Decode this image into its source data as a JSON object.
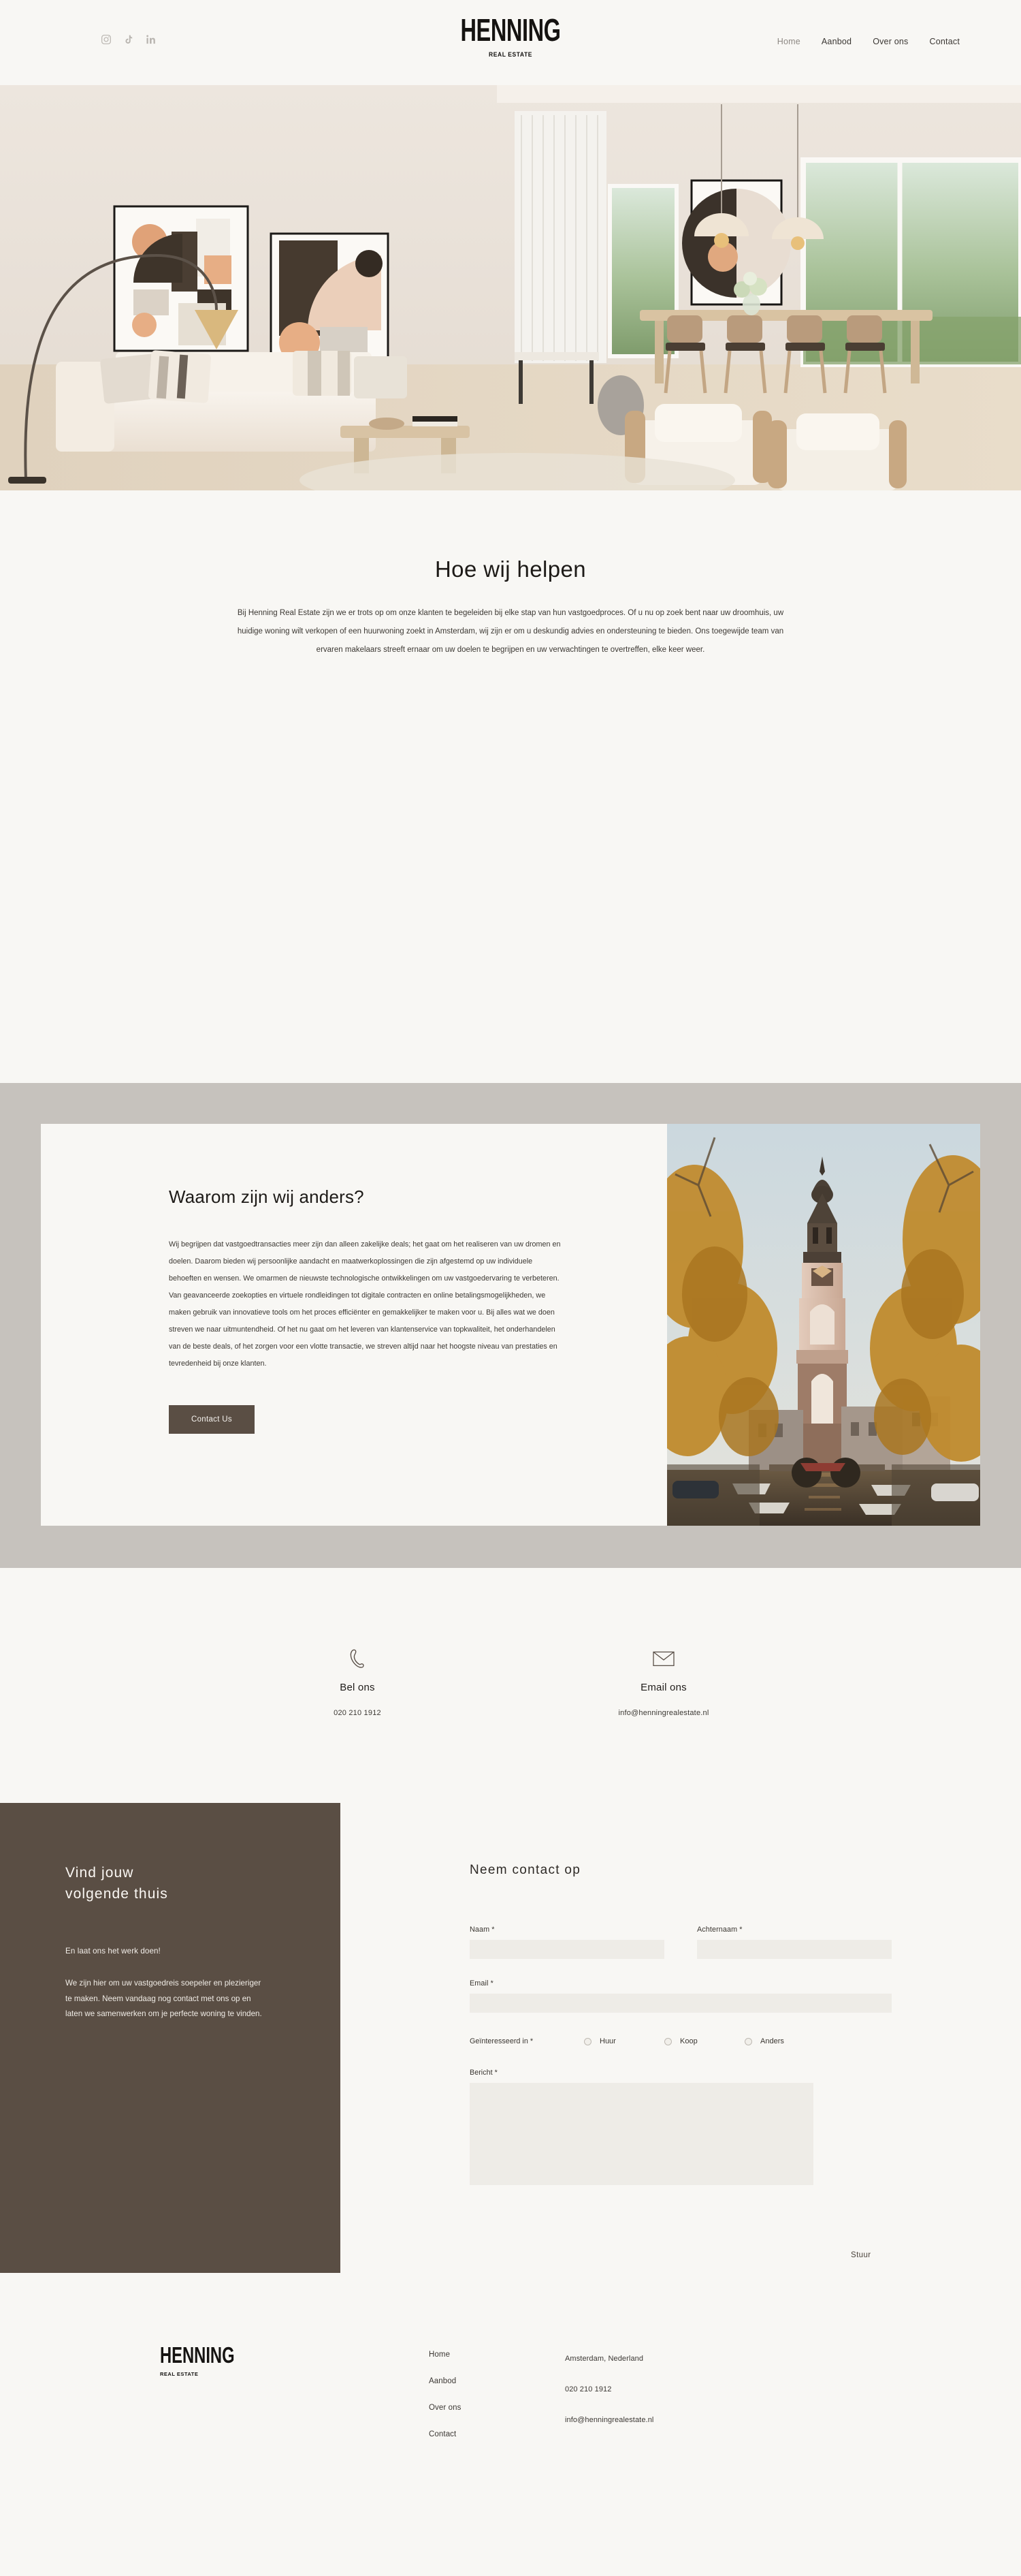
{
  "header": {
    "socials": [
      {
        "name": "instagram",
        "label": "Instagram"
      },
      {
        "name": "tiktok",
        "label": "TikTok"
      },
      {
        "name": "linkedin",
        "label": "LinkedIn"
      }
    ],
    "brand_name": "HENNING",
    "brand_sub": "REAL ESTATE",
    "nav": [
      {
        "label": "Home",
        "active": true
      },
      {
        "label": "Aanbod",
        "active": false
      },
      {
        "label": "Over ons",
        "active": false
      },
      {
        "label": "Contact",
        "active": false
      }
    ]
  },
  "hero": {
    "alt": "Modern beige living room with white sectional sofa, abstract framed art, arc floor lamp and dining area with garden view"
  },
  "help": {
    "title": "Hoe wij helpen",
    "body": "Bij Henning Real Estate zijn we er trots op om onze klanten te begeleiden bij elke stap van hun vastgoedproces. Of u nu op zoek bent naar uw droomhuis, uw huidige woning wilt verkopen of een huurwoning zoekt in Amsterdam, wij zijn er om u deskundig advies en ondersteuning te bieden. Ons toegewijde team van ervaren makelaars streeft ernaar om uw doelen te begrijpen en uw verwachtingen te overtreffen, elke keer weer."
  },
  "why": {
    "title": "Waarom zijn wij anders?",
    "body": "Wij begrijpen dat vastgoedtransacties meer zijn dan alleen zakelijke deals; het gaat om het realiseren van uw dromen en doelen. Daarom bieden wij persoonlijke aandacht en maatwerkoplossingen die zijn afgestemd op uw individuele behoeften en wensen. We omarmen de nieuwste technologische ontwikkelingen om uw vastgoedervaring te verbeteren. Van geavanceerde zoekopties en virtuele rondleidingen tot digitale contracten en online betalingsmogelijkheden, we maken gebruik van innovatieve tools om het proces efficiënter en gemakkelijker te maken voor u. Bij alles wat we doen streven we naar uitmuntendheid. Of het nu gaat om het leveren van klantenservice van topkwaliteit, het onderhandelen van de beste deals, of het zorgen voor een vlotte transactie, we streven altijd naar het hoogste niveau van prestaties en tevredenheid bij onze klanten.",
    "button": "Contact Us",
    "photo_alt": "Amsterdam canal in autumn with the Zuiderkerk church tower, golden trees and moored boats"
  },
  "contact_tiles": [
    {
      "icon": "phone-icon",
      "heading": "Bel ons",
      "value": "020 210 1912"
    },
    {
      "icon": "envelope-icon",
      "heading": "Email ons",
      "value": "info@henningrealestate.nl"
    }
  ],
  "promo": {
    "title": "Vind jouw\nvolgende thuis",
    "title_line1": "Vind jouw",
    "title_line2": "volgende thuis",
    "lead": "En laat ons het werk doen!",
    "body": "We zijn hier om uw vastgoedreis soepeler en plezieriger te maken. Neem vandaag nog contact met ons op en laten we samenwerken om je perfecte woning te vinden."
  },
  "form": {
    "title": "Neem contact op",
    "first_name_label": "Naam *",
    "first_name_value": "",
    "last_name_label": "Achternaam *",
    "last_name_value": "",
    "email_label": "Email *",
    "email_value": "",
    "interest_label": "Geïnteresseerd in *",
    "interest_options": [
      "Huur",
      "Koop",
      "Anders"
    ],
    "message_label": "Bericht *",
    "message_value": "",
    "submit_label": "Stuur"
  },
  "footer": {
    "brand_name": "HENNING",
    "brand_sub": "REAL ESTATE",
    "nav": [
      "Home",
      "Aanbod",
      "Over ons",
      "Contact"
    ],
    "info": [
      "Amsterdam, Nederland",
      "020 210 1912",
      "info@henningrealestate.nl"
    ]
  },
  "colors": {
    "page_bg": "#F8F7F4",
    "band_gray": "#C6C2BD",
    "brown": "#5A4E44",
    "input_bg": "#EEECE7",
    "text": "#3C3833"
  }
}
